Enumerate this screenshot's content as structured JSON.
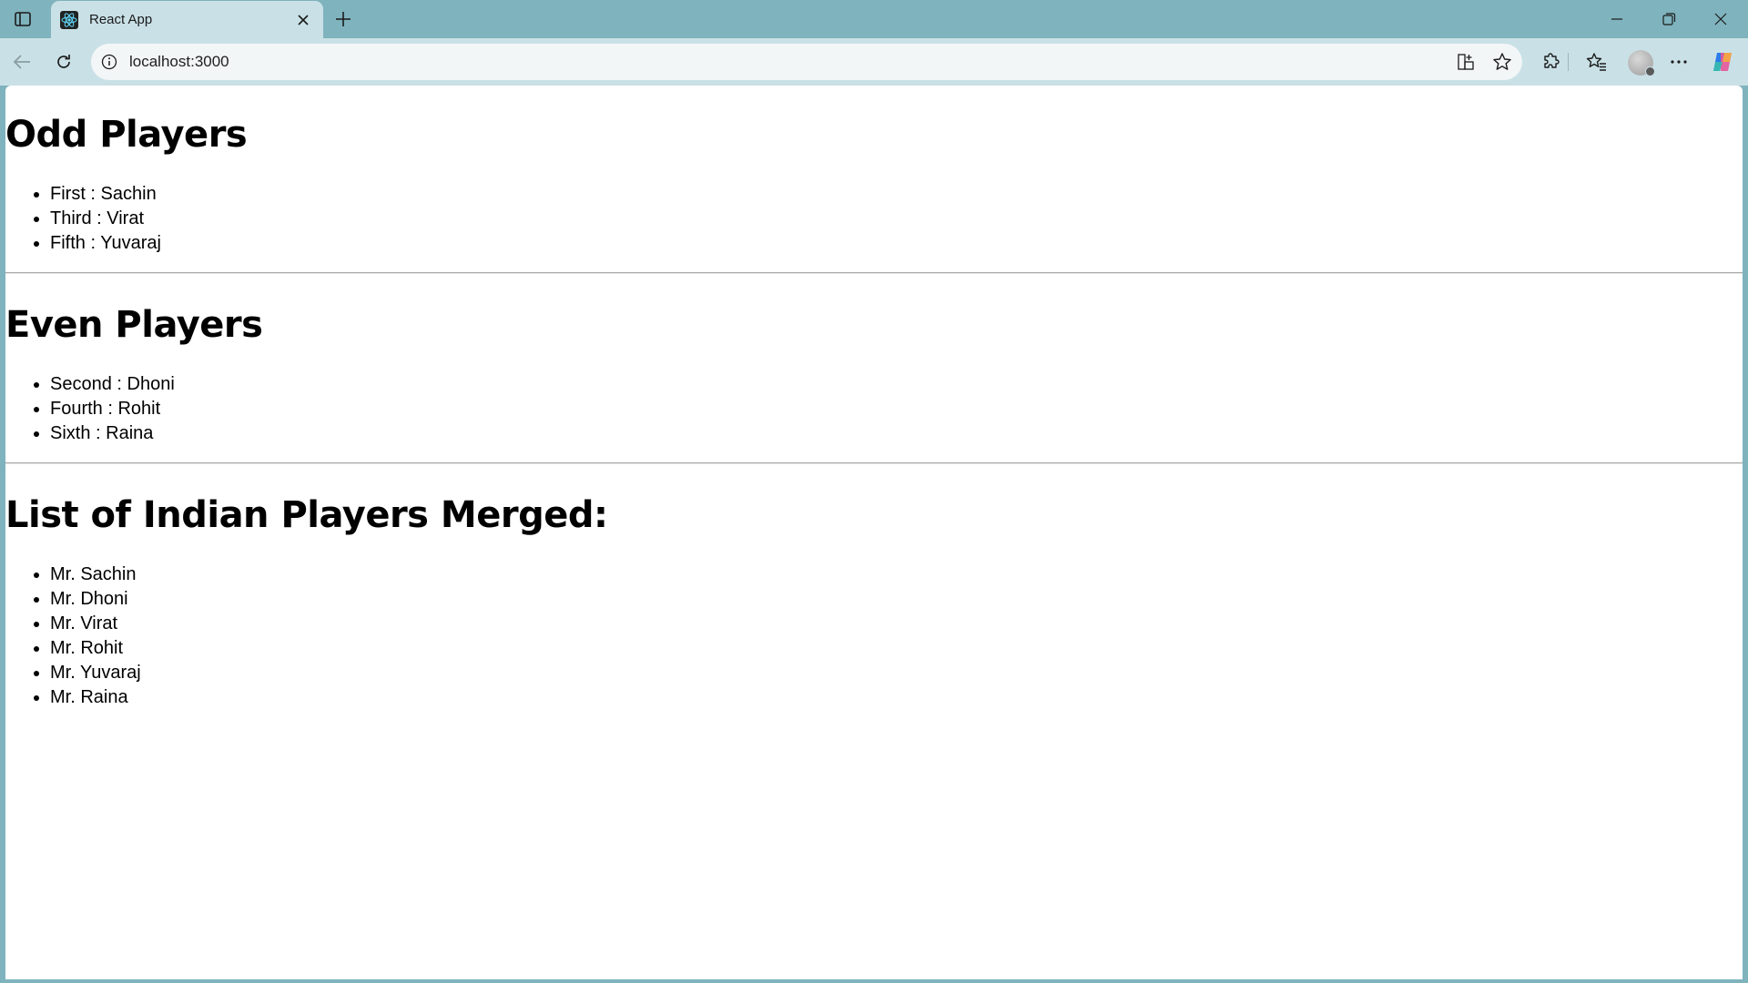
{
  "browser": {
    "tab": {
      "title": "React App",
      "favicon": "react-logo-icon"
    },
    "address": {
      "url": "localhost:3000"
    },
    "icons": {
      "sidebar": "sidebar-toggle-icon",
      "new_tab": "plus-icon",
      "back": "back-arrow-icon",
      "refresh": "refresh-icon",
      "site_info": "info-icon",
      "app_view": "app-grid-icon",
      "favorite": "star-icon",
      "extensions": "puzzle-icon",
      "favorites": "favorites-icon",
      "more": "more-icon",
      "copilot": "copilot-icon"
    },
    "colors": {
      "titlebar": "#7fb3bd",
      "toolbar": "#c9e1e6",
      "page": "#ffffff"
    }
  },
  "page": {
    "odd": {
      "heading": "Odd Players",
      "items": [
        "First : Sachin",
        "Third : Virat",
        "Fifth : Yuvaraj"
      ]
    },
    "even": {
      "heading": "Even Players",
      "items": [
        "Second : Dhoni",
        "Fourth : Rohit",
        "Sixth : Raina"
      ]
    },
    "merged": {
      "heading": "List of Indian Players Merged:",
      "items": [
        "Mr. Sachin",
        "Mr. Dhoni",
        "Mr. Virat",
        "Mr. Rohit",
        "Mr. Yuvaraj",
        "Mr. Raina"
      ]
    }
  }
}
